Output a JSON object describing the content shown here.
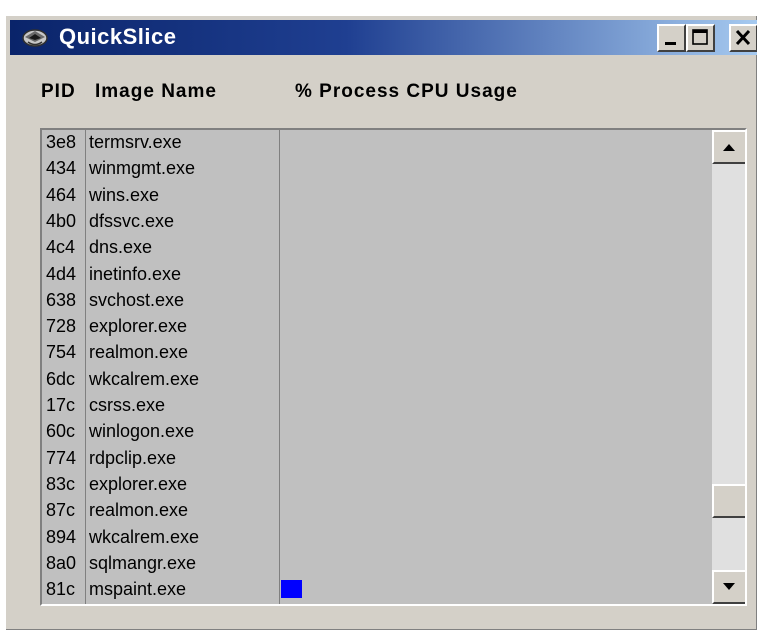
{
  "window": {
    "title": "QuickSlice",
    "icon": "quickslice-app-icon",
    "controls": [
      "minimize-icon",
      "maximize-icon",
      "close-icon"
    ]
  },
  "columns": {
    "pid": "PID",
    "image_name": "Image Name",
    "cpu_usage": "% Process CPU Usage"
  },
  "processes": [
    {
      "pid": "3e8",
      "name": "termsrv.exe",
      "cpu": 0
    },
    {
      "pid": "434",
      "name": "winmgmt.exe",
      "cpu": 0
    },
    {
      "pid": "464",
      "name": "wins.exe",
      "cpu": 0
    },
    {
      "pid": "4b0",
      "name": "dfssvc.exe",
      "cpu": 0
    },
    {
      "pid": "4c4",
      "name": "dns.exe",
      "cpu": 0
    },
    {
      "pid": "4d4",
      "name": "inetinfo.exe",
      "cpu": 0
    },
    {
      "pid": "638",
      "name": "svchost.exe",
      "cpu": 0
    },
    {
      "pid": "728",
      "name": "explorer.exe",
      "cpu": 0
    },
    {
      "pid": "754",
      "name": "realmon.exe",
      "cpu": 0
    },
    {
      "pid": "6dc",
      "name": "wkcalrem.exe",
      "cpu": 0
    },
    {
      "pid": "17c",
      "name": "csrss.exe",
      "cpu": 0
    },
    {
      "pid": "60c",
      "name": "winlogon.exe",
      "cpu": 0
    },
    {
      "pid": "774",
      "name": "rdpclip.exe",
      "cpu": 0
    },
    {
      "pid": "83c",
      "name": "explorer.exe",
      "cpu": 0
    },
    {
      "pid": "87c",
      "name": "realmon.exe",
      "cpu": 0
    },
    {
      "pid": "894",
      "name": "wkcalrem.exe",
      "cpu": 0
    },
    {
      "pid": "8a0",
      "name": "sqlmangr.exe",
      "cpu": 0
    },
    {
      "pid": "81c",
      "name": "mspaint.exe",
      "cpu": 5.5
    }
  ],
  "scrollbar": {
    "position_fraction": 0.86
  },
  "colors": {
    "titlebar_start": "#0a246a",
    "titlebar_end": "#a6caf0",
    "cpu_bar": "#0000ff",
    "window_face": "#d4d0c8",
    "list_background": "#c0c0c0"
  }
}
